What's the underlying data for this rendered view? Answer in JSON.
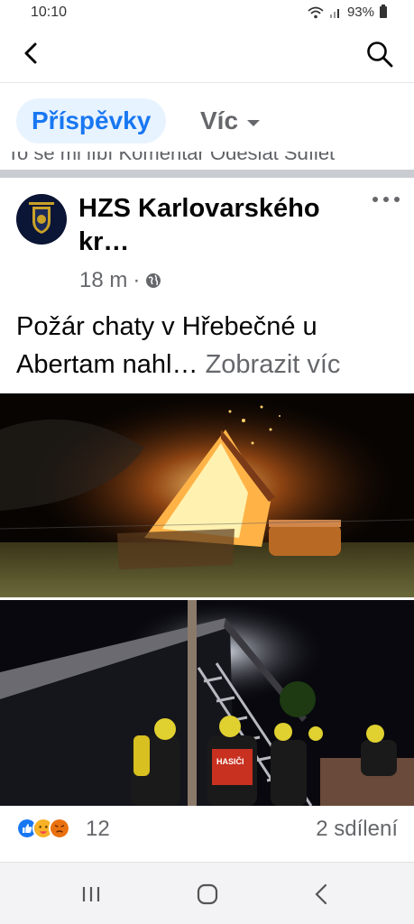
{
  "status_bar": {
    "time": "10:10",
    "battery": "93%",
    "icons": [
      "wifi-icon",
      "signal-icon",
      "battery-icon"
    ]
  },
  "top_bar": {
    "back_icon": "back-arrow-icon",
    "search_icon": "search-icon"
  },
  "tabs": {
    "active": "Příspěvky",
    "more": "Víc"
  },
  "cut_off_row": "To se mi líbí Komentář Odeslat Sdílet",
  "post": {
    "page_name": "HZS Karlovarského kr…",
    "time": "18 m",
    "separator": "·",
    "privacy_icon": "globe-icon",
    "text": "Požár chaty v Hřebečné u Abertam nahl…",
    "see_more": "Zobrazit víc",
    "reactions": {
      "icons": [
        "like-icon",
        "care-icon",
        "angry-icon"
      ],
      "count": "12"
    },
    "shares": "2 sdílení",
    "photo_labels": [
      "HASIČI"
    ]
  },
  "nav_bar": {
    "items": [
      "recent-apps-icon",
      "home-icon",
      "back-icon"
    ]
  },
  "colors": {
    "accent": "#1877f2",
    "accent_bg": "#e7f3ff",
    "secondary_text": "#65676b",
    "divider": "#c9ccd1"
  }
}
